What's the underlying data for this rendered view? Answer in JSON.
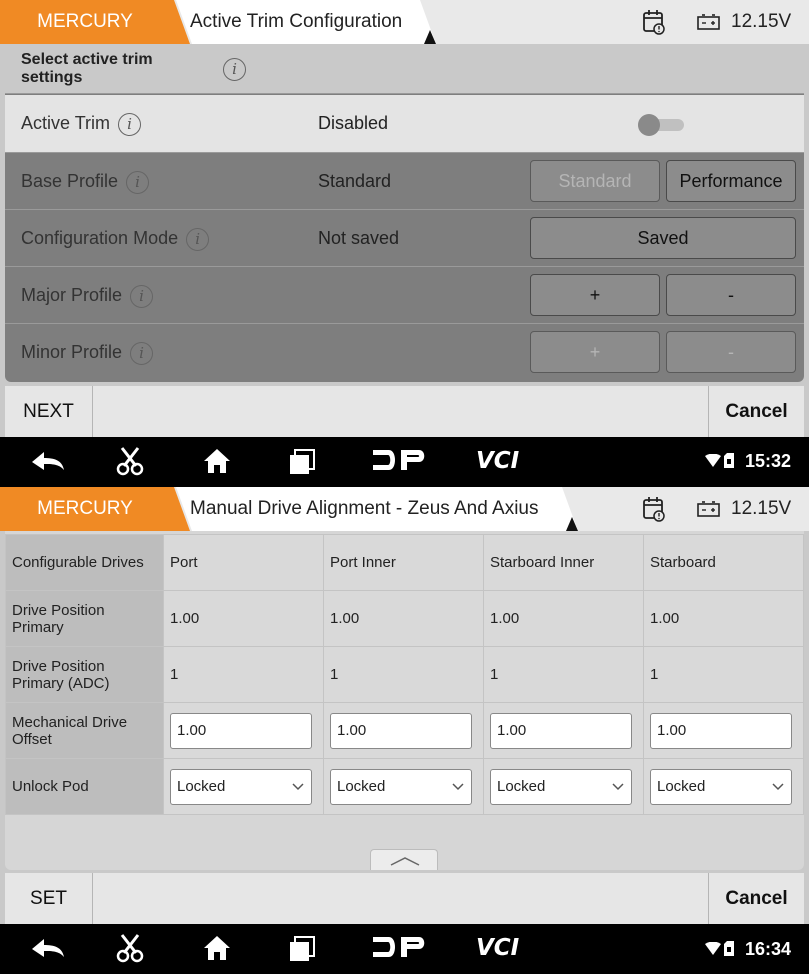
{
  "screen1": {
    "header": {
      "brand": "MERCURY",
      "title": "Active Trim Configuration",
      "voltage": "12.15V"
    },
    "section_title": "Select active trim settings",
    "rows": [
      {
        "label": "Active Trim",
        "value": "Disabled"
      },
      {
        "label": "Base Profile",
        "value": "Standard",
        "buttons": [
          "Standard",
          "Performance"
        ]
      },
      {
        "label": "Configuration Mode",
        "value": "Not saved",
        "buttons": [
          "Saved"
        ]
      },
      {
        "label": "Major Profile",
        "value": "",
        "buttons": [
          "+",
          "-"
        ]
      },
      {
        "label": "Minor Profile",
        "value": "",
        "buttons": [
          "+",
          "-"
        ]
      }
    ],
    "toggle": {
      "state": "off"
    },
    "footer": {
      "left": "NEXT",
      "right": "Cancel"
    },
    "nav": {
      "time": "15:32",
      "logo_dp": "DP",
      "logo_vci": "VCI"
    }
  },
  "screen2": {
    "header": {
      "brand": "MERCURY",
      "title": "Manual Drive Alignment - Zeus And Axius",
      "voltage": "12.15V"
    },
    "columns": [
      "Configurable Drives",
      "Port",
      "Port Inner",
      "Starboard Inner",
      "Starboard"
    ],
    "rows": [
      {
        "label": "Drive Position Primary",
        "values": [
          "1.00",
          "1.00",
          "1.00",
          "1.00"
        ]
      },
      {
        "label": "Drive Position Primary (ADC)",
        "values": [
          "1",
          "1",
          "1",
          "1"
        ]
      },
      {
        "label": "Mechanical Drive Offset",
        "values": [
          "1.00",
          "1.00",
          "1.00",
          "1.00"
        ]
      },
      {
        "label": "Unlock Pod",
        "values": [
          "Locked",
          "Locked",
          "Locked",
          "Locked"
        ]
      }
    ],
    "footer": {
      "left": "SET",
      "right": "Cancel"
    },
    "nav": {
      "time": "16:34",
      "logo_dp": "DP",
      "logo_vci": "VCI"
    }
  },
  "colors": {
    "brand": "#f08a24",
    "header_bg": "#e9e9e9",
    "panel_bg": "#7e7e7e",
    "table_bg": "#d6d6d6",
    "nav_bg": "#000000"
  },
  "icons": [
    "calendar-alert-icon",
    "battery-icon",
    "back-icon",
    "scissors-icon",
    "home-icon",
    "recent-apps-icon",
    "dp-logo",
    "vci-logo",
    "wifi-icon",
    "sim-icon",
    "info-icon",
    "chevron-down-icon",
    "chevron-up-icon"
  ]
}
